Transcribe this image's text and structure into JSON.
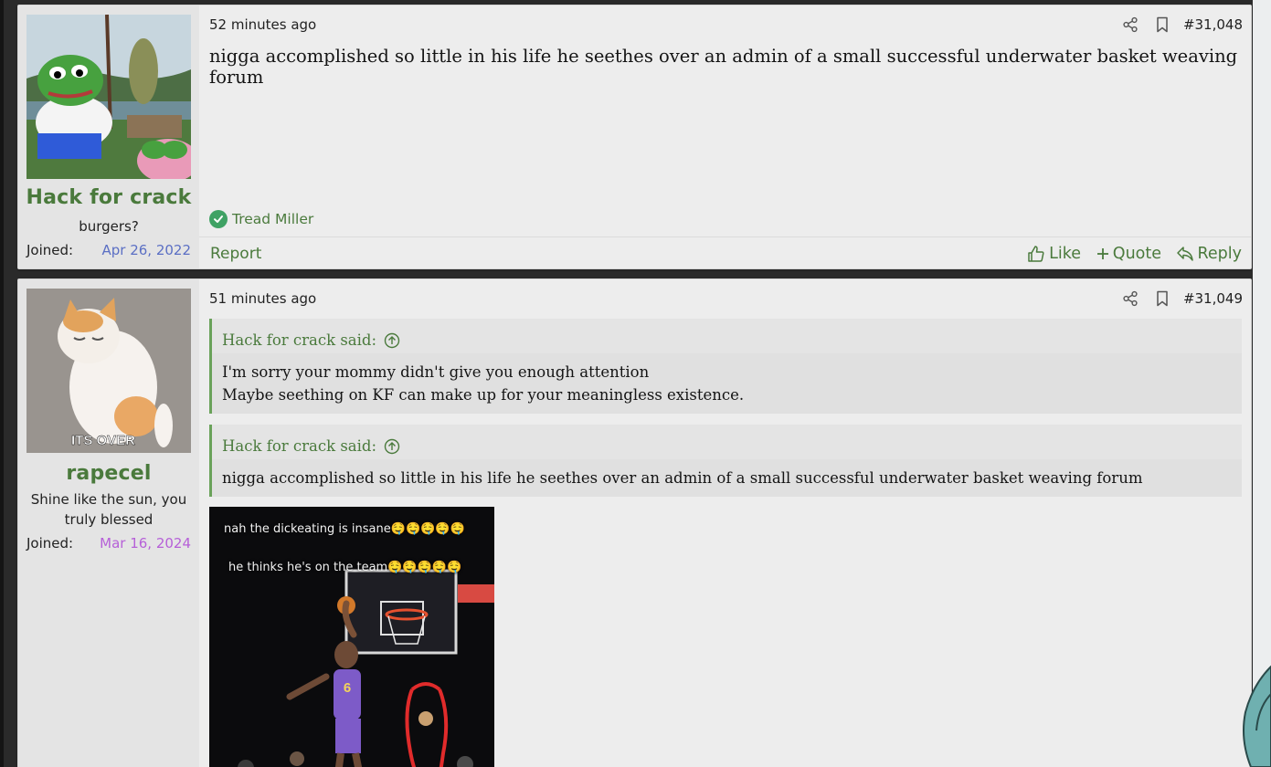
{
  "posts": [
    {
      "username": "Hack for crack",
      "user_title": "burgers?",
      "joined_label": "Joined:",
      "joined_date": "Apr 26, 2022",
      "time": "52 minutes ago",
      "post_number": "#31,048",
      "body": "nigga accomplished so little in his life he seethes over an admin of a small successful underwater basket weaving forum",
      "reaction_user": "Tread Miller",
      "report_label": "Report",
      "like_label": "Like",
      "quote_label": "Quote",
      "reply_label": "Reply"
    },
    {
      "username": "rapecel",
      "user_title": "Shine like the sun, you truly blessed",
      "joined_label": "Joined:",
      "joined_date": "Mar 16, 2024",
      "avatar_caption": "ITS OVER",
      "time": "51 minutes ago",
      "post_number": "#31,049",
      "quotes": [
        {
          "attribution": "Hack for crack said:",
          "lines": [
            "I'm sorry your mommy didn't give you enough attention",
            "Maybe seething on KF can make up for your meaningless existence."
          ]
        },
        {
          "attribution": "Hack for crack said:",
          "lines": [
            "nigga accomplished so little in his life he seethes over an admin of a small successful underwater basket weaving forum"
          ]
        }
      ],
      "gif_caption_1": "nah the dickeating is insane🤤🤤🤤🤤🤤",
      "gif_caption_2": "he thinks he's on the team🤤🤤🤤🤤🤤",
      "gif_jersey_number": "6"
    }
  ],
  "colors": {
    "username": "#4a7a3c",
    "joined_date_1": "#5b6fc4",
    "joined_date_2": "#b660d8",
    "accent_green": "#4a7a3c",
    "reaction_green": "#3fa264"
  },
  "icons": [
    "share-icon",
    "bookmark-icon",
    "thumbs-up-icon",
    "plus-icon",
    "reply-icon",
    "check-icon",
    "arrow-up-circle-icon"
  ]
}
